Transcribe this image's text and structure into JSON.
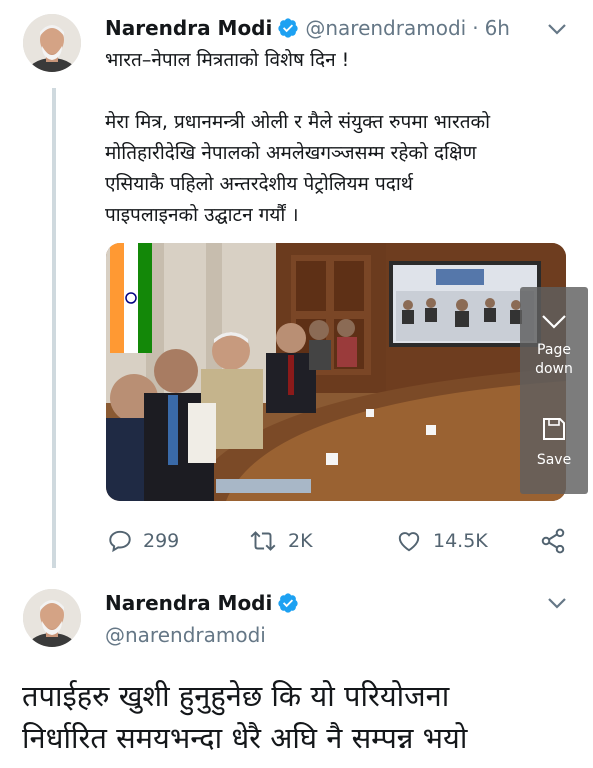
{
  "tweet1": {
    "author_name": "Narendra Modi",
    "handle": "@narendramodi",
    "separator": "·",
    "time": "6h",
    "title_line": "भारत–नेपाल मित्रताको विशेष दिन !",
    "body_lines": [
      "मेरा मित्र, प्रधानमन्त्री ओली र मैले संयुक्त रुपमा भारतको",
      "मोतिहारीदेखि नेपालको अमलेखगञ्जसम्म रहेको दक्षिण",
      "एसियाकै पहिलो अन्तरदेशीय पेट्रोलियम पदार्थ",
      "पाइपलाइनको उद्घाटन गर्यौं ।"
    ],
    "actions": {
      "replies": "299",
      "retweets": "2K",
      "likes": "14.5K"
    }
  },
  "overlay": {
    "page_down_line1": "Page",
    "page_down_line2": "down",
    "save_label": "Save"
  },
  "tweet2": {
    "author_name": "Narendra Modi",
    "handle": "@narendramodi",
    "text_lines": [
      "तपाईहरु खुशी हुनुहुनेछ कि यो परियोजना",
      "निर्धारित समयभन्दा धेरै अघि नै सम्पन्न भयो"
    ]
  },
  "colors": {
    "verified_blue": "#1da1f2",
    "secondary_text": "#657786",
    "thread_line": "#cfd9de"
  },
  "icons": [
    "verified-badge-icon",
    "chevron-down-icon",
    "reply-icon",
    "retweet-icon",
    "like-icon",
    "share-icon",
    "page-down-icon",
    "save-icon"
  ]
}
